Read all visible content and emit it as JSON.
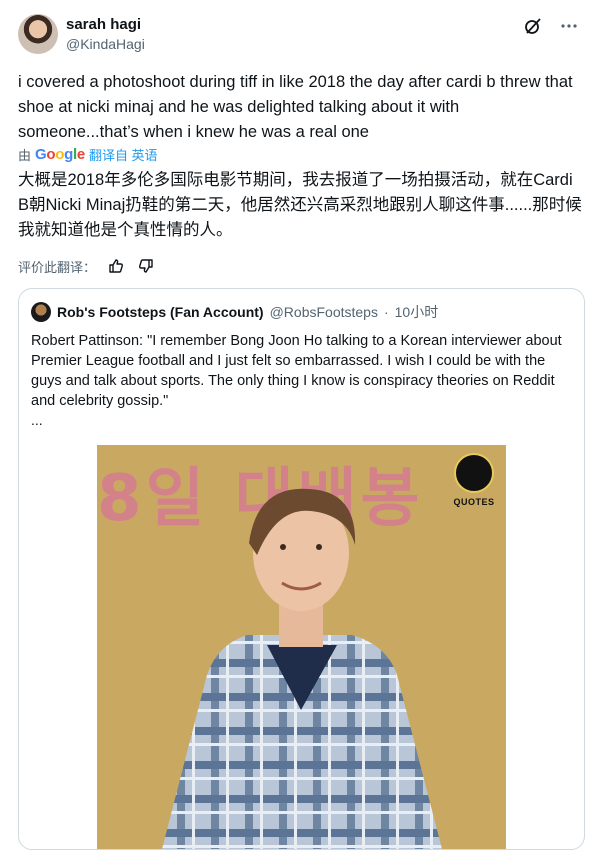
{
  "author": {
    "name": "sarah hagi",
    "handle": "@KindaHagi"
  },
  "tweet": {
    "text": "i covered a photoshoot during tiff in like 2018 the day after cardi b threw that shoe at nicki minaj and he was delighted talking about it with someone...that’s when i knew he was a real one"
  },
  "translation": {
    "prefix": "由",
    "provider": "Google",
    "link": "翻译自 英语",
    "text": "大概是2018年多伦多国际电影节期间，我去报道了一场拍摄活动，就在Cardi B朝Nicki Minaj扔鞋的第二天，他居然还兴高采烈地跟别人聊这件事......那时候我就知道他是个真性情的人。",
    "rate_label": "评价此翻译："
  },
  "quote": {
    "name": "Rob's Footsteps (Fan Account)",
    "handle": "@RobsFootsteps",
    "separator": "·",
    "time": "10小时",
    "text": "Robert Pattinson: \"I remember Bong Joon Ho talking to a Korean interviewer about Premier League football and I just felt so embarrassed. I wish I could be with the guys and talk about sports. The only thing I know is conspiracy theories on Reddit and celebrity gossip.\"",
    "ellipsis": "...",
    "image": {
      "background_text": "8일 대배봉",
      "badge_label": "QUOTES"
    }
  },
  "icons": {
    "grok": "grok-icon",
    "more": "more-icon",
    "thumbs_up": "thumbs-up-icon",
    "thumbs_down": "thumbs-down-icon"
  },
  "colors": {
    "link": "#1d9bf0",
    "secondary": "#536471",
    "text": "#0f1419"
  }
}
